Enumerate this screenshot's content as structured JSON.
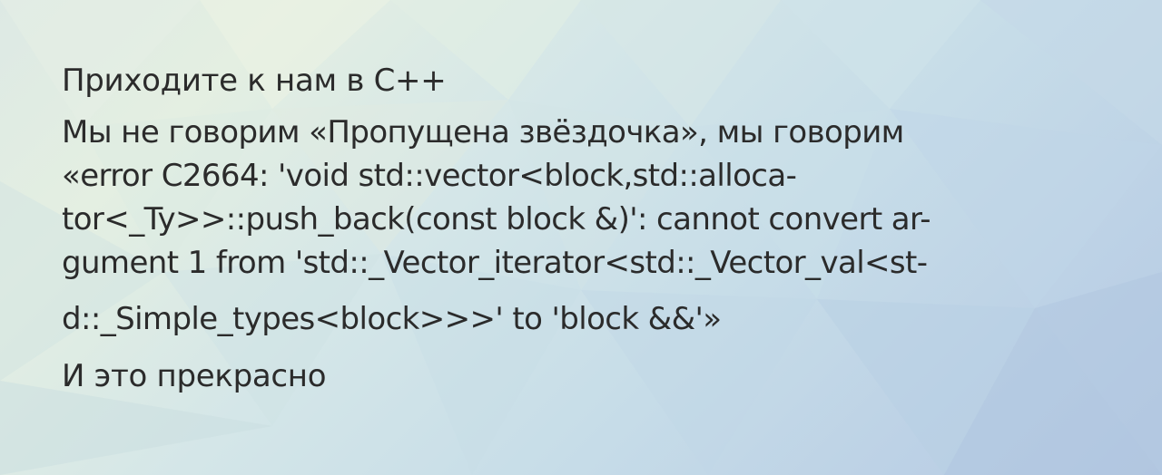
{
  "headline": "Приходите к нам в C++",
  "body_lines": [
    "Мы не говорим «Пропущена звёздочка», мы говорим",
    "«error C2664: 'void std::vector<block,std::alloca-",
    "tor<_Ty>>::push_back(const block &)': cannot convert ar-",
    "gument 1 from 'std::_Vector_iterator<std::_Vector_val<st-",
    "d::_Simple_types<block>>>' to 'block &&'»"
  ],
  "closing": "И это прекрасно",
  "colors": {
    "text": "#2b2b2b",
    "background_light": "#e4efe2",
    "background_dark": "#b5c9e2"
  }
}
